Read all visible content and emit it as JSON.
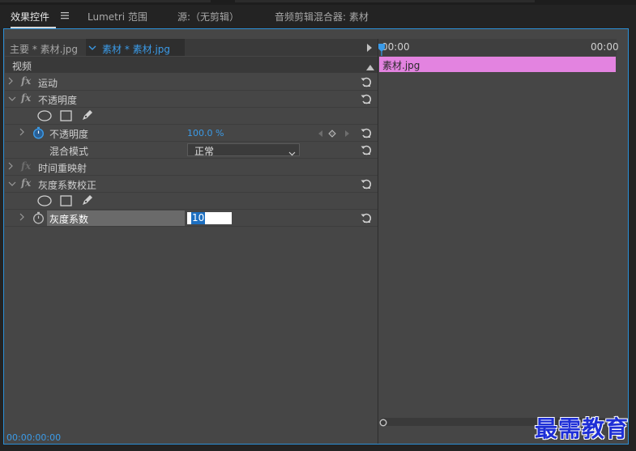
{
  "tabs": [
    {
      "label": "效果控件"
    },
    {
      "label": "Lumetri 范围"
    },
    {
      "label": "源:（无剪辑）"
    },
    {
      "label": "音频剪辑混合器: 素材"
    }
  ],
  "source": {
    "master_label": "主要 * 素材.jpg",
    "clip_label": "素材 * 素材.jpg"
  },
  "ruler": {
    "start": "00:00",
    "end": "00:00"
  },
  "video_header": "视频",
  "effects": {
    "motion": "运动",
    "opacity": "不透明度",
    "opacity_param": "不透明度",
    "opacity_value": "100.0 %",
    "blend_label": "混合模式",
    "blend_value": "正常",
    "time_remap": "时间重映射",
    "gamma": "灰度系数校正",
    "gamma_param": "灰度系数",
    "gamma_value": "10"
  },
  "timeline_clip": "素材.jpg",
  "timecode": "00:00:00:00",
  "watermark": "最需教育",
  "colors": {
    "accent": "#2b8fd6",
    "clip": "#e383e0",
    "watermark": "#1e2fd6"
  },
  "icons": [
    "menu-icon",
    "chevron-right-icon",
    "chevron-down-icon",
    "fx-icon",
    "reset-icon",
    "ellipse-mask-icon",
    "rectangle-mask-icon",
    "pen-mask-icon",
    "stopwatch-icon",
    "keyframe-nav-icon",
    "playhead-icon"
  ]
}
